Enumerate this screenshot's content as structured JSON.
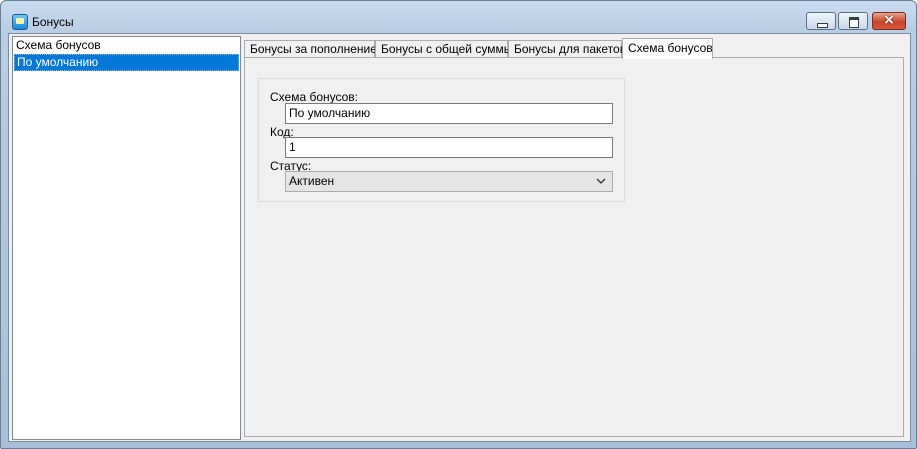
{
  "window": {
    "title": "Бонусы",
    "controls": [
      "minimize",
      "maximize",
      "close"
    ],
    "close_glyph": "×"
  },
  "list": {
    "items": [
      "Схема бонусов",
      "По умолчанию"
    ],
    "selected_index": 1
  },
  "tabs": [
    {
      "label": "Бонусы за пополнение"
    },
    {
      "label": "Бонусы с общей суммы"
    },
    {
      "label": "Бонусы для пакетов"
    },
    {
      "label": "Схема бонусов"
    }
  ],
  "active_tab": "Схема бонусов",
  "form": {
    "scheme_label": "Схема бонусов:",
    "scheme_value": "По умолчанию",
    "code_label": "Код:",
    "code_value": "1",
    "status_label": "Статус:",
    "status_value": "Активен"
  },
  "icons": {
    "app": "bonus-app-icon",
    "dropdown": "chevron-down-icon"
  },
  "colors": {
    "selection": "#0078d7",
    "close_button": "#c8452c",
    "frame": "#b9cde4"
  }
}
